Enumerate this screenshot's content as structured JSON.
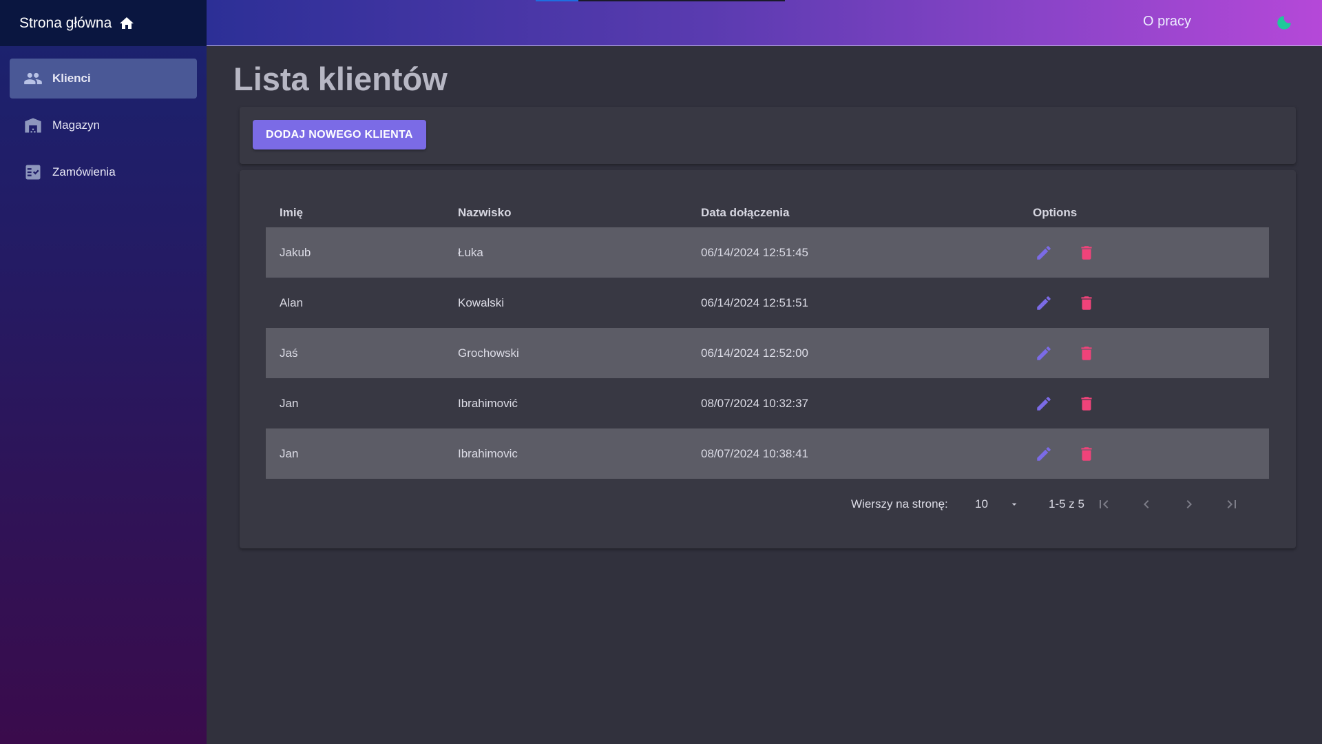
{
  "app": {
    "home_label": "Strona główna",
    "about_label": "O pracy",
    "accent_color": "#7b6be6",
    "delete_color": "#f0437a",
    "progress_fraction": 0.17
  },
  "sidebar": {
    "items": [
      {
        "label": "Klienci",
        "icon": "people-icon",
        "active": true
      },
      {
        "label": "Magazyn",
        "icon": "warehouse-icon",
        "active": false
      },
      {
        "label": "Zamówienia",
        "icon": "orders-icon",
        "active": false
      }
    ]
  },
  "main": {
    "title": "Lista klientów",
    "add_button_label": "DODAJ NOWEGO KLIENTA",
    "table": {
      "columns": [
        "Imię",
        "Nazwisko",
        "Data dołączenia",
        "Options"
      ],
      "rows": [
        {
          "first_name": "Jakub",
          "last_name": "Łuka",
          "joined": "06/14/2024 12:51:45"
        },
        {
          "first_name": "Alan",
          "last_name": "Kowalski",
          "joined": "06/14/2024 12:51:51"
        },
        {
          "first_name": "Jaś",
          "last_name": "Grochowski",
          "joined": "06/14/2024 12:52:00"
        },
        {
          "first_name": "Jan",
          "last_name": "Ibrahimović",
          "joined": "08/07/2024 10:32:37"
        },
        {
          "first_name": "Jan",
          "last_name": "Ibrahimovic",
          "joined": "08/07/2024 10:38:41"
        }
      ]
    },
    "pagination": {
      "rows_per_page_label": "Wierszy na stronę:",
      "rows_per_page": "10",
      "range": "1-5 z 5"
    }
  }
}
